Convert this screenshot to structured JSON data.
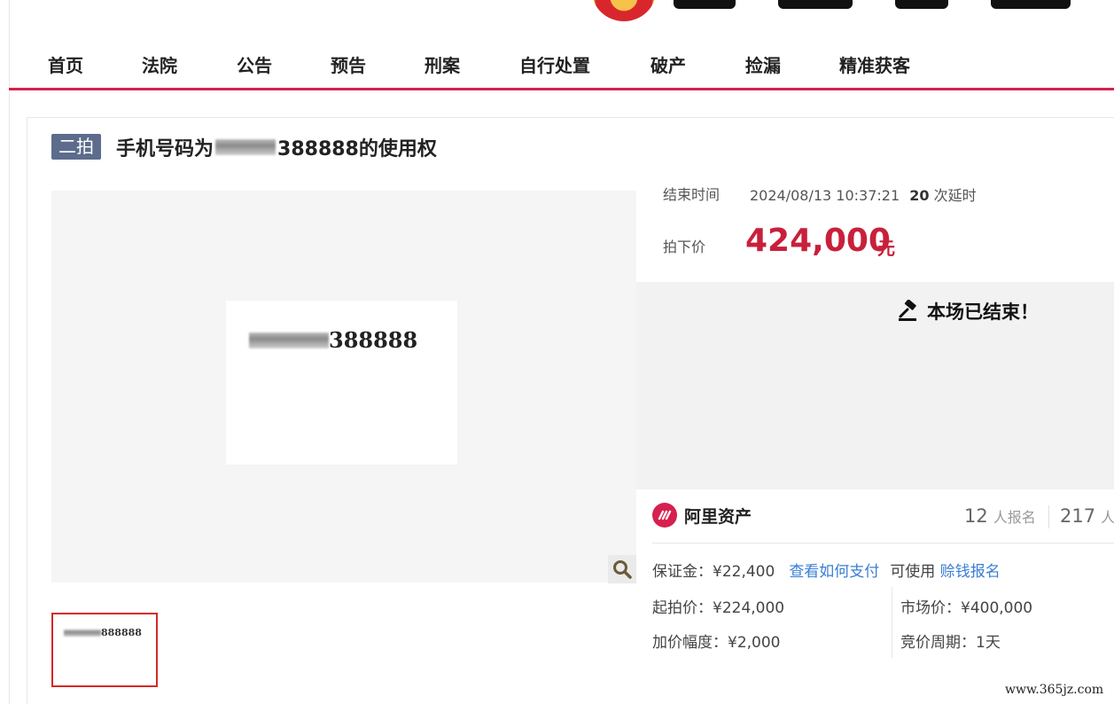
{
  "nav": {
    "items": [
      "首页",
      "法院",
      "公告",
      "预告",
      "刑案",
      "自行处置",
      "破产",
      "捡漏",
      "精准获客"
    ]
  },
  "listing": {
    "badge": "二拍",
    "title_prefix": "手机号码为",
    "title_suffix": "388888的使用权",
    "image_number_suffix": "388888",
    "thumb_number_suffix": "888888"
  },
  "auction": {
    "end_label": "结束时间",
    "end_time": "2024/08/13 10:37:21",
    "delay_count": "20",
    "delay_label": "次延时",
    "price_label": "拍下价",
    "price": "424,000",
    "price_unit": "元",
    "ended_message": "本场已结束！"
  },
  "platform": {
    "brand_name": "阿里资产",
    "registrations_count": "12",
    "registrations_label": "人报名",
    "views_count": "217",
    "views_label": "人"
  },
  "terms": {
    "deposit": "保证金：¥22,400",
    "how_to_pay": "查看如何支付",
    "usable": "可使用",
    "earn_register": "赊钱报名",
    "start_price": "起拍价：¥224,000",
    "market_price": "市场价：¥400,000",
    "increment": "加价幅度：¥2,000",
    "cycle": "竞价周期：1天"
  },
  "watermark": "www.365jz.com",
  "colors": {
    "accent": "#d6204e",
    "price": "#c8203b",
    "link": "#3a7fd5",
    "badge": "#5d6c8c"
  },
  "icons": {
    "gavel": "gavel-icon",
    "zoom": "magnifier-icon",
    "brand": "ali-assets-logo-icon"
  }
}
